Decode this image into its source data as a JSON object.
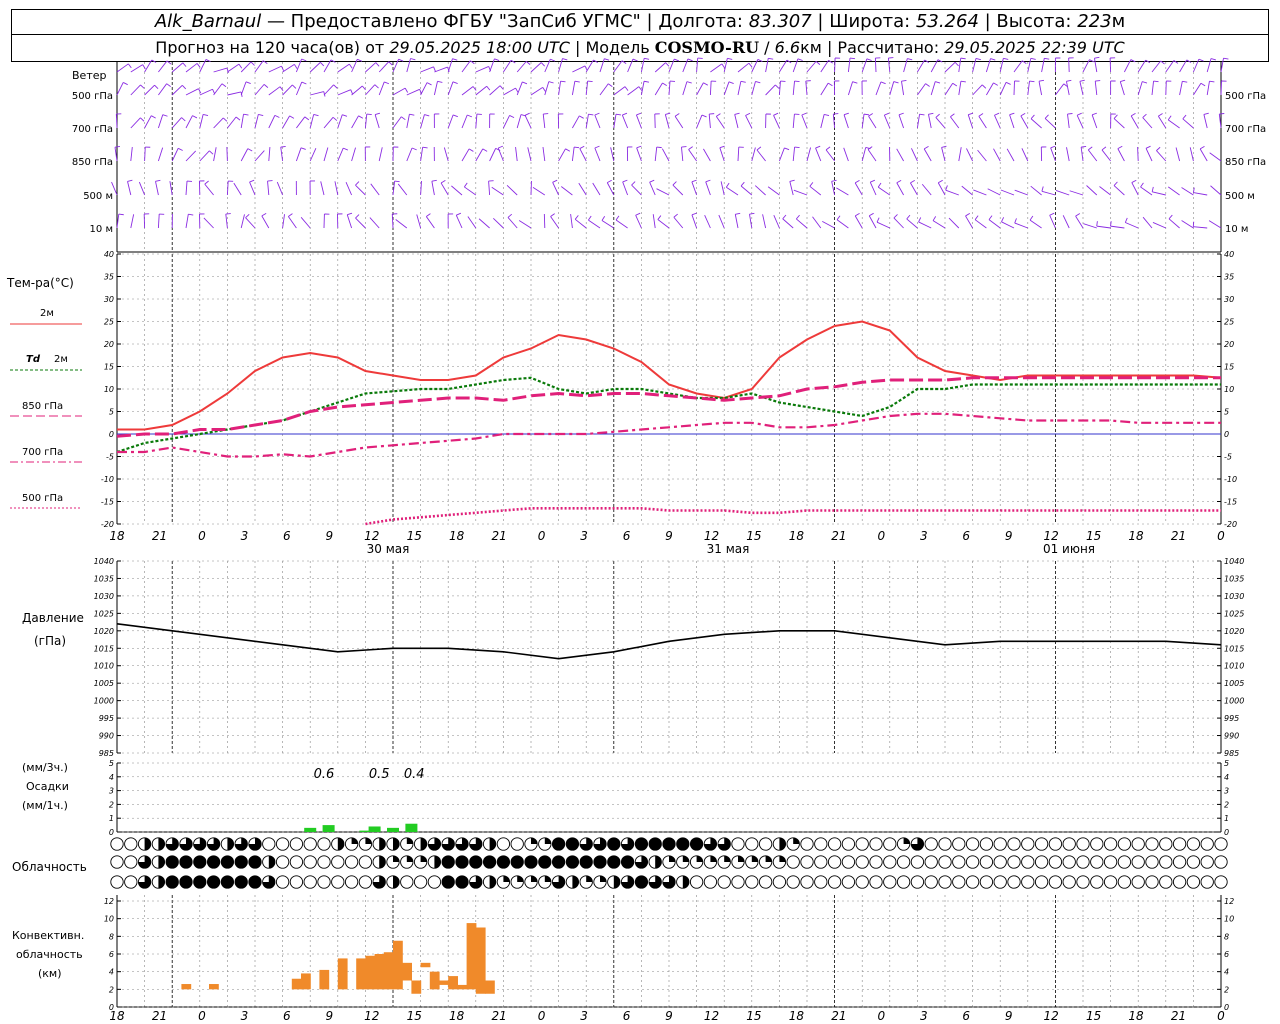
{
  "header": {
    "station": "Alk_Barnaul",
    "provider": "— Предоставлено ФГБУ \"ЗапСиб УГМС\"",
    "lon_label": "| Долгота:",
    "lon": "83.307",
    "lat_label": "| Широта:",
    "lat": "53.264",
    "alt_label": "| Высота:",
    "alt": "223",
    "alt_unit": "м",
    "fc_label": "Прогноз на 120 часа(ов) от",
    "fc_start": "29.05.2025 18:00 UTC",
    "model_label": "| Модель",
    "model_name": "COSMO-RU",
    "model_sep": "/",
    "model_res": "6.6",
    "model_res_unit": "км",
    "calc_label": "| Рассчитано:",
    "calc_time": "29.05.2025 22:39 UTC"
  },
  "labels": {
    "wind": "Ветер",
    "temp": "Тем-ра(°С)",
    "t2m": "2м",
    "td": "Td",
    "td2m": "2м",
    "t850": "850 гПа",
    "t700": "700 гПа",
    "t500": "500 гПа",
    "pressure": "Давление",
    "pressure_unit": "(гПа)",
    "precip_unit3": "(мм/3ч.)",
    "precip": "Осадки",
    "precip_unit1": "(мм/1ч.)",
    "clouds": "Облачность",
    "conv1": "Конвективн.",
    "conv2": "облачность",
    "conv_unit": "(км)"
  },
  "wind_levels": [
    "500 гПа",
    "700 гПа",
    "850 гПа",
    "500 м",
    "10  м"
  ],
  "time_ticks": [
    "18",
    "21",
    "0",
    "3",
    "6",
    "9",
    "12",
    "15",
    "18",
    "21",
    "0",
    "3",
    "6",
    "9",
    "12",
    "15",
    "18",
    "21",
    "0",
    "3",
    "6",
    "9",
    "12",
    "15",
    "18",
    "21",
    "0"
  ],
  "day_labels": [
    "30 мая",
    "31 мая",
    "01 июня"
  ],
  "chart_data": [
    {
      "type": "line",
      "title": "Тем-ра(°С)",
      "x_hours": [
        0,
        3,
        6,
        9,
        12,
        15,
        18,
        21,
        24,
        27,
        30,
        33,
        36,
        39,
        42,
        45,
        48,
        51,
        54,
        57,
        60,
        63,
        66,
        69,
        72,
        75,
        78,
        81,
        84,
        87,
        90,
        93,
        96,
        99,
        102,
        105,
        108,
        111,
        114,
        117,
        120
      ],
      "ylim": [
        -20,
        40
      ],
      "series": [
        {
          "name": "2м",
          "color": "#ee3a3a",
          "values": [
            1,
            1,
            2,
            5,
            9,
            14,
            17,
            18,
            17,
            14,
            13,
            12,
            12,
            13,
            17,
            19,
            22,
            21,
            19,
            16,
            11,
            9,
            8,
            10,
            17,
            21,
            24,
            25,
            23,
            17,
            14,
            13,
            12,
            13,
            13,
            13,
            13,
            13,
            13,
            13,
            12.5
          ]
        },
        {
          "name": "Td 2м",
          "color": "#0a7a0a",
          "values": [
            -4,
            -2,
            -1,
            0,
            1,
            2,
            3,
            5,
            7,
            9,
            9.5,
            10,
            10,
            11,
            12,
            12.5,
            10,
            9,
            10,
            10,
            9,
            8,
            8,
            9,
            7,
            6,
            5,
            4,
            6,
            10,
            10,
            11,
            11,
            11,
            11,
            11,
            11,
            11,
            11,
            11,
            11
          ]
        },
        {
          "name": "850 гПа",
          "color": "#e0207a",
          "values": [
            -0.5,
            0,
            0,
            1,
            1,
            2,
            3,
            5,
            6,
            6.5,
            7,
            7.5,
            8,
            8,
            7.5,
            8.5,
            9,
            8.5,
            9,
            9,
            8.5,
            8,
            7.5,
            8,
            8.5,
            10,
            10.5,
            11.5,
            12,
            12,
            12,
            12.5,
            12.5,
            12.5,
            12.5,
            12.5,
            12.5,
            12.5,
            12.5,
            12.5,
            12.5
          ]
        },
        {
          "name": "700 гПа",
          "color": "#e0207a",
          "values": [
            -4,
            -4,
            -3,
            -4,
            -5,
            -5,
            -4.5,
            -5,
            -4,
            -3,
            -2.5,
            -2,
            -1.5,
            -1,
            0,
            0,
            0,
            0,
            0.5,
            1,
            1.5,
            2,
            2.5,
            2.5,
            1.5,
            1.5,
            2,
            3,
            4,
            4.5,
            4.5,
            4,
            3.5,
            3,
            3,
            3,
            3,
            2.5,
            2.5,
            2.5,
            2.5
          ]
        },
        {
          "name": "500 гПа",
          "color": "#e0207a",
          "values": [
            null,
            null,
            null,
            null,
            null,
            null,
            null,
            null,
            null,
            -20,
            -19,
            -18.5,
            -18,
            -17.5,
            -17,
            -16.5,
            -16.5,
            -16.5,
            -16.5,
            -16.5,
            -17,
            -17,
            -17,
            -17.5,
            -17.5,
            -17,
            -17,
            -17,
            -17,
            -17,
            -17,
            -17,
            -17,
            -17,
            -17,
            -17,
            -17,
            -17,
            -17,
            -17,
            -17
          ]
        }
      ]
    },
    {
      "type": "line",
      "title": "Давление",
      "x_hours": [
        0,
        6,
        12,
        18,
        24,
        30,
        36,
        42,
        48,
        54,
        60,
        66,
        72,
        78,
        84,
        90,
        96,
        102,
        108,
        114,
        120
      ],
      "ylim": [
        985,
        1040
      ],
      "series": [
        {
          "name": "Давление",
          "color": "#000000",
          "values": [
            1022,
            1020,
            1018,
            1016,
            1014,
            1015,
            1015,
            1014,
            1012,
            1014,
            1017,
            1019,
            1020,
            1020,
            1018,
            1016,
            1017,
            1017,
            1017,
            1017,
            1016
          ]
        }
      ]
    },
    {
      "type": "bar",
      "title": "Осадки",
      "ylim": [
        0,
        5
      ],
      "bars": [
        {
          "hour": 21,
          "value": 0.3
        },
        {
          "hour": 23,
          "value": 0.5
        },
        {
          "hour": 27,
          "value": 0.1
        },
        {
          "hour": 28,
          "value": 0.4
        },
        {
          "hour": 30,
          "value": 0.3
        },
        {
          "hour": 32,
          "value": 0.6
        }
      ],
      "labels_3h": [
        {
          "hour": 22.5,
          "text": "0.6"
        },
        {
          "hour": 28.5,
          "text": "0.5"
        },
        {
          "hour": 32.3,
          "text": "0.4"
        }
      ]
    },
    {
      "type": "bar",
      "title": "Конвективн. облачность",
      "ylim": [
        0,
        12
      ],
      "bars": [
        {
          "hour": 7.5,
          "base": 2,
          "top": 2.6
        },
        {
          "hour": 10.5,
          "base": 2,
          "top": 2.6
        },
        {
          "hour": 19.5,
          "base": 2,
          "top": 3.2
        },
        {
          "hour": 20.5,
          "base": 2,
          "top": 3.8
        },
        {
          "hour": 22.5,
          "base": 2,
          "top": 4.2
        },
        {
          "hour": 24.5,
          "base": 2,
          "top": 5.5
        },
        {
          "hour": 26.5,
          "base": 2,
          "top": 5.5
        },
        {
          "hour": 27.5,
          "base": 2,
          "top": 5.8
        },
        {
          "hour": 28.5,
          "base": 2,
          "top": 6
        },
        {
          "hour": 29.5,
          "base": 2,
          "top": 6.2
        },
        {
          "hour": 30.5,
          "base": 2,
          "top": 7.5
        },
        {
          "hour": 31.5,
          "base": 3,
          "top": 5
        },
        {
          "hour": 32.5,
          "base": 1.5,
          "top": 3
        },
        {
          "hour": 33.5,
          "base": 4.5,
          "top": 4.5
        },
        {
          "hour": 34.5,
          "base": 2,
          "top": 4
        },
        {
          "hour": 35.5,
          "base": 2.5,
          "top": 3
        },
        {
          "hour": 36.5,
          "base": 2,
          "top": 3.5
        },
        {
          "hour": 37.5,
          "base": 2,
          "top": 2.5
        },
        {
          "hour": 38.5,
          "base": 2,
          "top": 9.5
        },
        {
          "hour": 39.5,
          "base": 1.5,
          "top": 9
        },
        {
          "hour": 40.5,
          "base": 1.5,
          "top": 3
        }
      ]
    }
  ],
  "clouds": {
    "row1": [
      0,
      0,
      2,
      2,
      3,
      3,
      3,
      3,
      2,
      3,
      3,
      0,
      0,
      0,
      0,
      0,
      2,
      1,
      1,
      2,
      2,
      1,
      2,
      3,
      3,
      3,
      3,
      2,
      0,
      0,
      1,
      1,
      4,
      4,
      3,
      3,
      4,
      3,
      4,
      4,
      4,
      4,
      4,
      3,
      3,
      0,
      0,
      0,
      2,
      1,
      0,
      0,
      0,
      0,
      0,
      0,
      0,
      1,
      3,
      0,
      0,
      0,
      0,
      0,
      0,
      0,
      0,
      0,
      0,
      0,
      0,
      0,
      0,
      0,
      0,
      0,
      0,
      0,
      0,
      0,
      0
    ],
    "row2": [
      0,
      0,
      3,
      2,
      4,
      4,
      4,
      4,
      4,
      4,
      4,
      2,
      0,
      0,
      0,
      0,
      0,
      0,
      0,
      2,
      1,
      1,
      1,
      2,
      4,
      4,
      4,
      4,
      4,
      4,
      4,
      4,
      4,
      4,
      4,
      4,
      4,
      4,
      3,
      2,
      1,
      1,
      1,
      1,
      1,
      1,
      1,
      1,
      1,
      0,
      0,
      0,
      0,
      0,
      0,
      0,
      0,
      0,
      0,
      0,
      0,
      0,
      0,
      0,
      0,
      0,
      0,
      0,
      0,
      0,
      0,
      0,
      0,
      0,
      0,
      0,
      0,
      0,
      0,
      0,
      0
    ],
    "row3": [
      0,
      0,
      3,
      2,
      4,
      4,
      4,
      4,
      4,
      4,
      4,
      3,
      0,
      0,
      0,
      0,
      0,
      0,
      0,
      3,
      2,
      0,
      0,
      0,
      4,
      4,
      3,
      2,
      1,
      1,
      1,
      1,
      3,
      2,
      1,
      1,
      2,
      3,
      4,
      3,
      3,
      2,
      0,
      0,
      0,
      0,
      0,
      0,
      0,
      0,
      0,
      0,
      0,
      0,
      0,
      0,
      0,
      0,
      0,
      0,
      0,
      0,
      0,
      0,
      0,
      0,
      0,
      0,
      0,
      0,
      0,
      0,
      0,
      0,
      0,
      0,
      0,
      0,
      0,
      0,
      0
    ]
  },
  "colors": {
    "wind_barbs": "#8a2be2",
    "zero_line": "#3333cc",
    "precip_bars": "#22cc22",
    "conv_bars": "#f08a2a",
    "grid": "#888888"
  }
}
